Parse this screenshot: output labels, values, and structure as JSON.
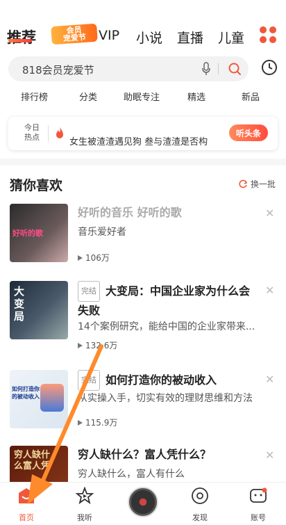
{
  "top_tabs": [
    {
      "label": "推荐"
    },
    {
      "label": "VIP"
    },
    {
      "label": "小说"
    },
    {
      "label": "直播"
    },
    {
      "label": "儿童"
    }
  ],
  "promo": {
    "line1": "会员",
    "line2": "宠爱节"
  },
  "search": {
    "placeholder": "818会员宠爱节"
  },
  "categories": [
    "排行榜",
    "分类",
    "助眠专注",
    "精选",
    "新品"
  ],
  "headline": {
    "today_label": "今日热点",
    "text": "女生被渣渣遇见狗 叁与渣渣是否构",
    "button_label": "听头条"
  },
  "section": {
    "title": "猜你喜欢",
    "refresh_label": "换一批"
  },
  "items": [
    {
      "title": "好听的音乐 好听的歌",
      "desc": "音乐爱好者",
      "plays": "106万",
      "cover_text": "好听的歌"
    },
    {
      "badge": "完结",
      "title": "大变局：中国企业家为什么会失败",
      "desc": "14个案例研究，能给中国的企业家带来...",
      "plays": "132.6万",
      "cover_text": "大变局"
    },
    {
      "badge": "完结",
      "title": "如何打造你的被动收入",
      "desc": "从实操入手，切实有效的理财思维和方法",
      "plays": "115.9万",
      "cover_text": "如何打造你的被动收入"
    },
    {
      "title": "穷人缺什么？富人凭什么？",
      "desc": "穷人缺什么，富人有什么",
      "cover_text": "穷人缺什么富人凭"
    }
  ],
  "bottom_nav": [
    {
      "label": "首页",
      "icon": "home-icon"
    },
    {
      "label": "我听",
      "icon": "star-icon"
    },
    {
      "label": "发现",
      "icon": "discover-icon"
    },
    {
      "label": "账号",
      "icon": "account-icon"
    }
  ],
  "colors": {
    "accent": "#f0583c",
    "arrow": "#ff8a2b"
  }
}
